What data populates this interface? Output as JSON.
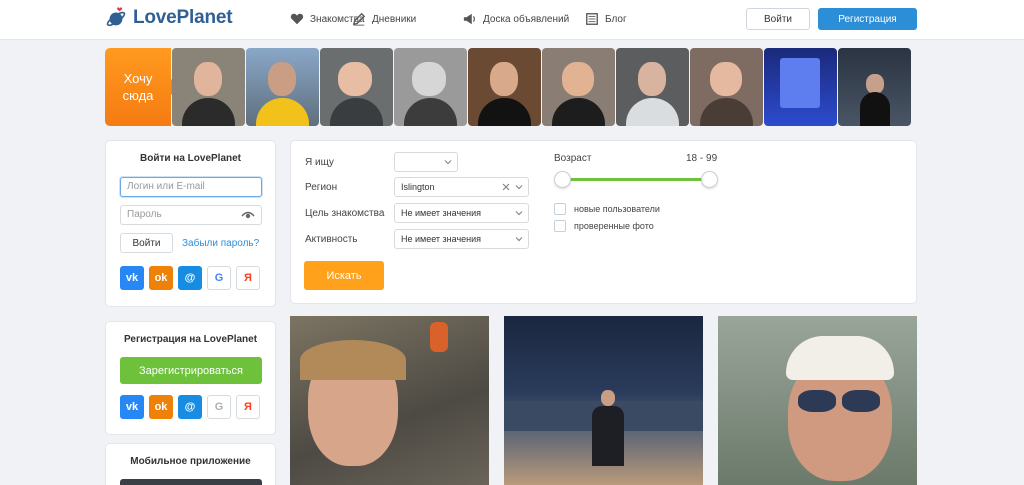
{
  "header": {
    "logo_text": "LovePlanet",
    "nav": [
      {
        "label": "Знакомства",
        "icon": "heart-icon"
      },
      {
        "label": "Дневники",
        "icon": "pen-icon"
      },
      {
        "label": "Доска объявлений",
        "icon": "megaphone-icon"
      },
      {
        "label": "Блог",
        "icon": "newspaper-icon"
      }
    ],
    "login_label": "Войти",
    "register_label": "Регистрация"
  },
  "strip": {
    "want_here_line1": "Хочу",
    "want_here_line2": "сюда"
  },
  "login": {
    "title": "Войти на LovePlanet",
    "login_placeholder": "Логин или E-mail",
    "password_placeholder": "Пароль",
    "submit_label": "Войти",
    "forgot_label": "Забыли пароль?"
  },
  "social": {
    "vk": "vk",
    "ok": "ok",
    "mail": "@",
    "google": "G",
    "yandex": "Я"
  },
  "register": {
    "title": "Регистрация на LovePlanet",
    "button_label": "Зарегистрироваться"
  },
  "mobile": {
    "title": "Мобильное приложение"
  },
  "search": {
    "looking_for_label": "Я ищу",
    "looking_for_value": "",
    "region_label": "Регион",
    "region_value": "Islington",
    "goal_label": "Цель знакомства",
    "goal_value": "Не имеет значения",
    "activity_label": "Активность",
    "activity_value": "Не имеет значения",
    "age_label": "Возраст",
    "age_range": "18 - 99",
    "age_min": 18,
    "age_max": 99,
    "new_users_label": "новые пользователи",
    "verified_label": "проверенные фото",
    "search_button": "Искать"
  },
  "colors": {
    "brand_blue": "#2d8ed8",
    "green": "#6ec13b",
    "orange": "#ffa11b"
  }
}
